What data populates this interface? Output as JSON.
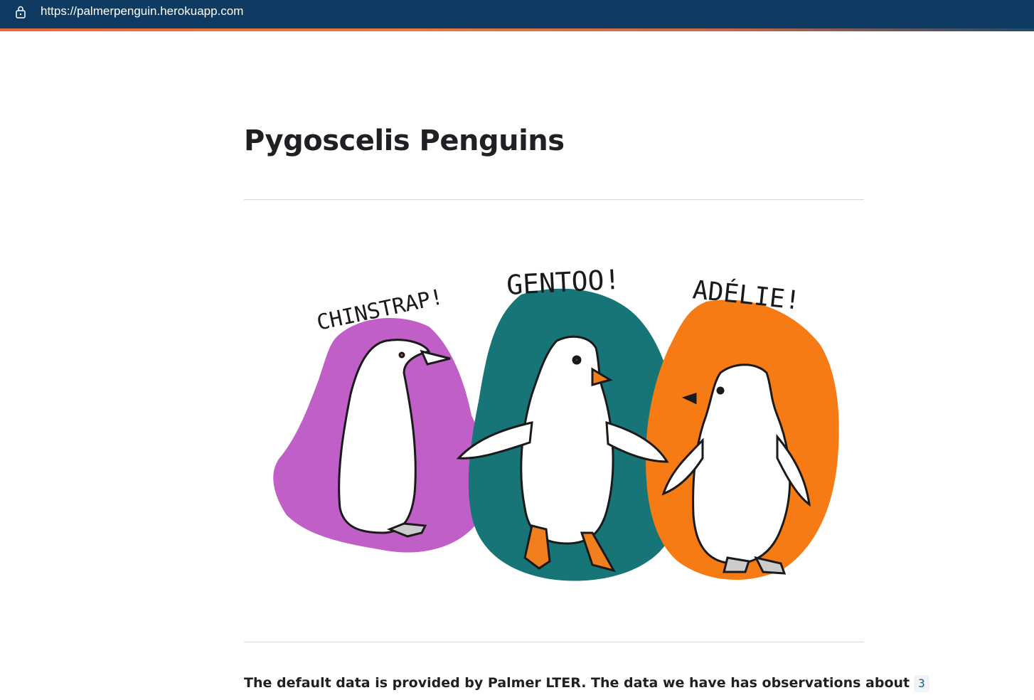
{
  "browser": {
    "url": "https://palmerpenguin.herokuapp.com"
  },
  "page": {
    "title": "Pygoscelis Penguins",
    "intro_text": "The default data is provided by Palmer LTER. The data we have has observations about",
    "intro_count": "3"
  },
  "illustration": {
    "labels": {
      "chinstrap": "CHINSTRAP!",
      "gentoo": "GENTOO!",
      "adelie": "ADÉLIE!"
    },
    "colors": {
      "chinstrap": "#c15fc9",
      "gentoo": "#177577",
      "adelie": "#f77b14",
      "feet": "#f27f1e"
    }
  },
  "theme": {
    "url_bar": "#0f3a61",
    "accent": "#e46b3a",
    "text": "#1f1f24",
    "divider": "#d8d8dc"
  }
}
